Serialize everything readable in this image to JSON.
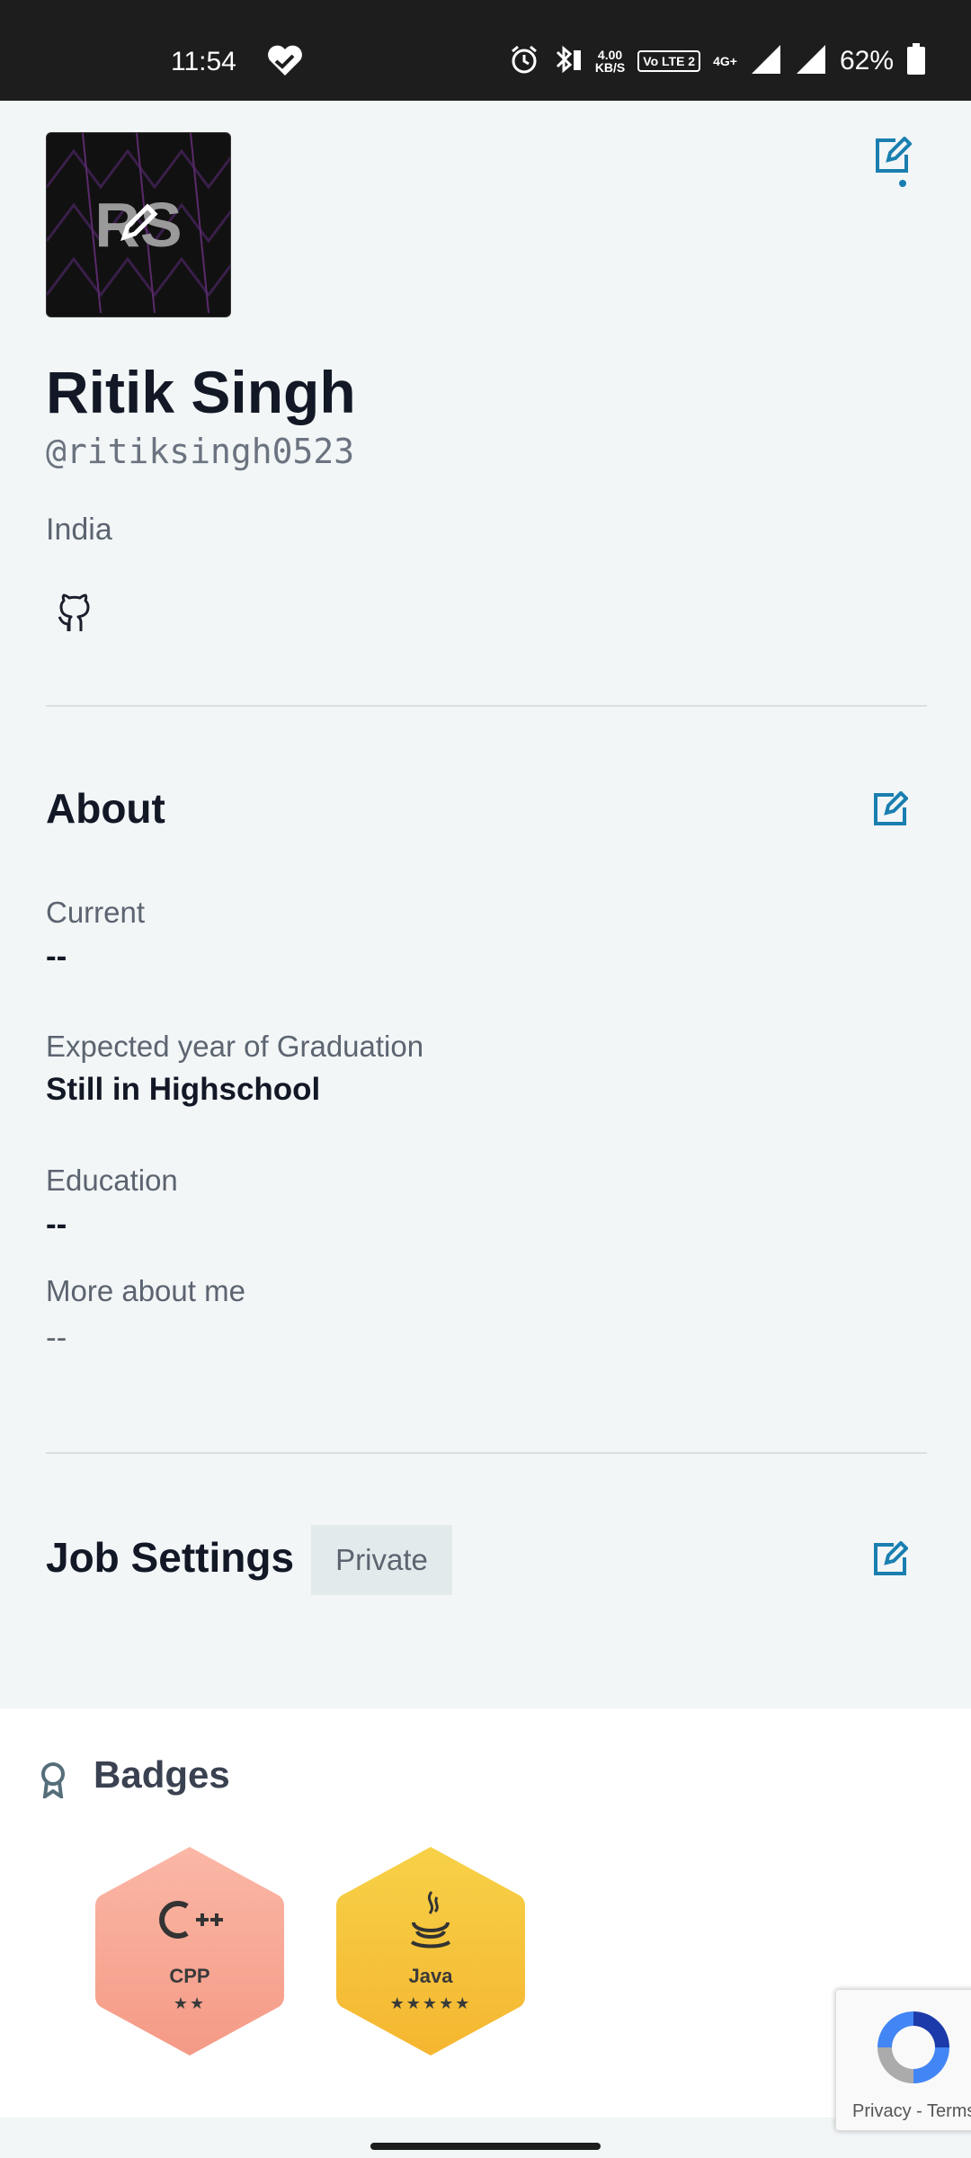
{
  "status_bar": {
    "time": "11:54",
    "net_speed_value": "4.00",
    "net_speed_unit": "KB/S",
    "volte_label": "Vo LTE 2",
    "network_type": "4G+",
    "battery": "62%"
  },
  "profile": {
    "avatar_initials": "RS",
    "name": "Ritik Singh",
    "username": "@ritiksingh0523",
    "country": "India"
  },
  "about": {
    "title": "About",
    "fields": [
      {
        "label": "Current",
        "value": "--"
      },
      {
        "label": "Expected year of Graduation",
        "value": "Still in Highschool"
      },
      {
        "label": "Education",
        "value": "--"
      },
      {
        "label": "More about me",
        "value": "--"
      }
    ]
  },
  "job_settings": {
    "title": "Job Settings",
    "visibility": "Private"
  },
  "badges": {
    "title": "Badges",
    "items": [
      {
        "label": "CPP",
        "stars": "★★",
        "icon": "cpp-icon",
        "color": "#f7a48d"
      },
      {
        "label": "Java",
        "stars": "★★★★★",
        "icon": "java-icon",
        "color": "#f6c13a"
      }
    ]
  },
  "recaptcha": {
    "text": "Privacy - Terms"
  },
  "colors": {
    "accent": "#1a7fb0",
    "background": "#f2f6f7"
  }
}
